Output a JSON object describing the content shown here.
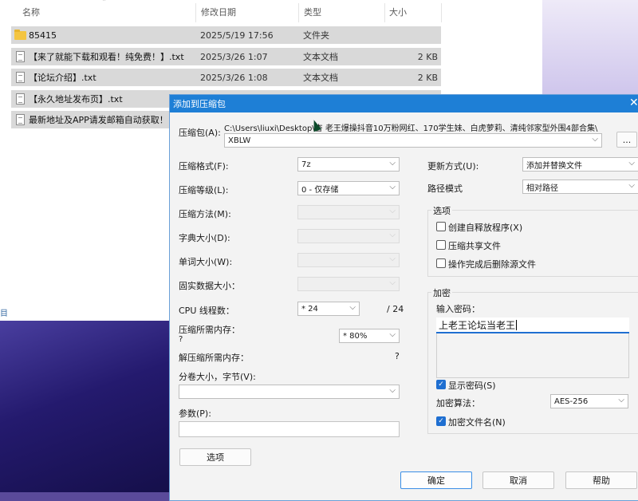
{
  "explorer": {
    "columns": {
      "name": "名称",
      "date": "修改日期",
      "type": "类型",
      "size": "大小"
    },
    "files": [
      {
        "name": "85415",
        "date": "2025/5/19 17:56",
        "type": "文件夹",
        "size": "",
        "icon": "folder-icon"
      },
      {
        "name": "【来了就能下载和观看！纯免费！】.txt",
        "date": "2025/3/26 1:07",
        "type": "文本文档",
        "size": "2 KB",
        "icon": "file-icon"
      },
      {
        "name": "【论坛介绍】.txt",
        "date": "2025/3/26 1:08",
        "type": "文本文档",
        "size": "2 KB",
        "icon": "file-icon"
      },
      {
        "name": "【永久地址发布页】.txt",
        "date": "",
        "type": "",
        "size": "",
        "icon": "file-icon"
      },
      {
        "name": "最新地址及APP请发邮箱自动获取！",
        "date": "",
        "type": "",
        "size": "",
        "icon": "file-icon"
      }
    ],
    "status_fragment": "目"
  },
  "dialog": {
    "title": "添加到压缩包",
    "archive_label": "压缩包(A):",
    "archive_path": "C:\\Users\\liuxi\\Desktop\\杏  老王爆操抖音10万粉网红、170学生妹、白虎萝莉、清纯邻家型外围4部合集\\",
    "archive_name": "XBLW",
    "browse_label": "...",
    "format_label": "压缩格式(F):",
    "format_value": "7z",
    "level_label": "压缩等级(L):",
    "level_value": "0 - 仅存储",
    "method_label": "压缩方法(M):",
    "dict_label": "字典大小(D):",
    "word_label": "单词大小(W):",
    "solid_label": "固实数据大小：",
    "cpu_label": "CPU 线程数：",
    "cpu_value": "* 24",
    "cpu_total": "/ 24",
    "mem_label": "压缩所需内存：",
    "mem_q": "?",
    "mem_value": "* 80%",
    "decomp_label": "解压缩所需内存：",
    "decomp_value": "?",
    "split_label": "分卷大小，字节(V):",
    "params_label": "参数(P):",
    "options_button": "选项",
    "update_label": "更新方式(U):",
    "update_value": "添加并替换文件",
    "path_label": "路径模式",
    "path_value": "相对路径",
    "options_group": "选项",
    "opt_sfx": "创建自释放程序(X)",
    "opt_shared": "压缩共享文件",
    "opt_delete": "操作完成后删除源文件",
    "encrypt_group": "加密",
    "password_label": "输入密码：",
    "password_value": "上老王论坛当老王",
    "show_password": "显示密码(S)",
    "enc_method_label": "加密算法：",
    "enc_method_value": "AES-256",
    "encrypt_names": "加密文件名(N)",
    "ok": "确定",
    "cancel": "取消",
    "help": "帮助"
  }
}
